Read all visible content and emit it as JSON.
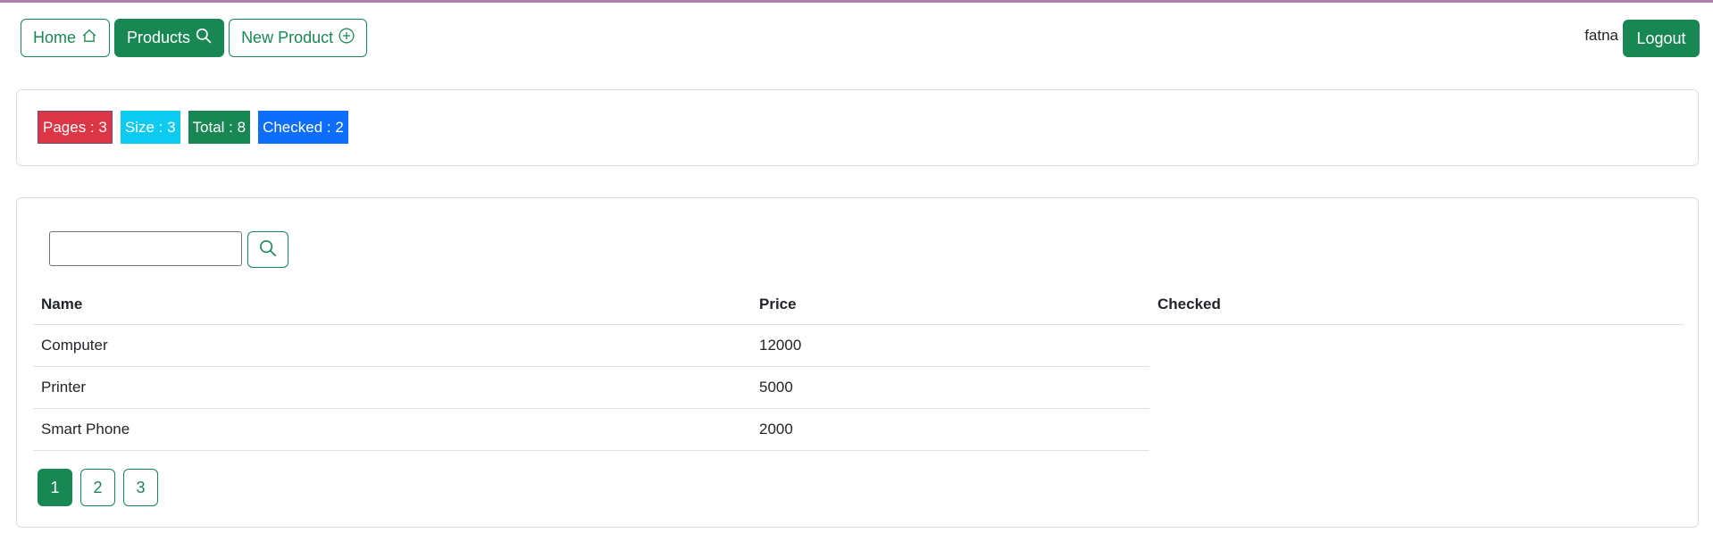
{
  "nav": {
    "home_label": "Home",
    "products_label": "Products",
    "new_product_label": "New Product"
  },
  "user": {
    "username": "fatna",
    "logout_label": "Logout"
  },
  "stats": {
    "pages": "Pages : 3",
    "size": "Size : 3",
    "total": "Total : 8",
    "checked": "Checked : 2"
  },
  "search": {
    "value": "",
    "placeholder": ""
  },
  "table": {
    "headers": [
      "Name",
      "Price",
      "Checked"
    ],
    "rows": [
      {
        "name": "Computer",
        "price": "12000",
        "checked": ""
      },
      {
        "name": "Printer",
        "price": "5000",
        "checked": ""
      },
      {
        "name": "Smart Phone",
        "price": "2000",
        "checked": ""
      }
    ]
  },
  "pagination": {
    "pages": [
      "1",
      "2",
      "3"
    ],
    "current": "1"
  },
  "colors": {
    "primary": "#198754",
    "danger": "#dc3545",
    "info": "#0dcaf0",
    "blue": "#0d6efd"
  }
}
